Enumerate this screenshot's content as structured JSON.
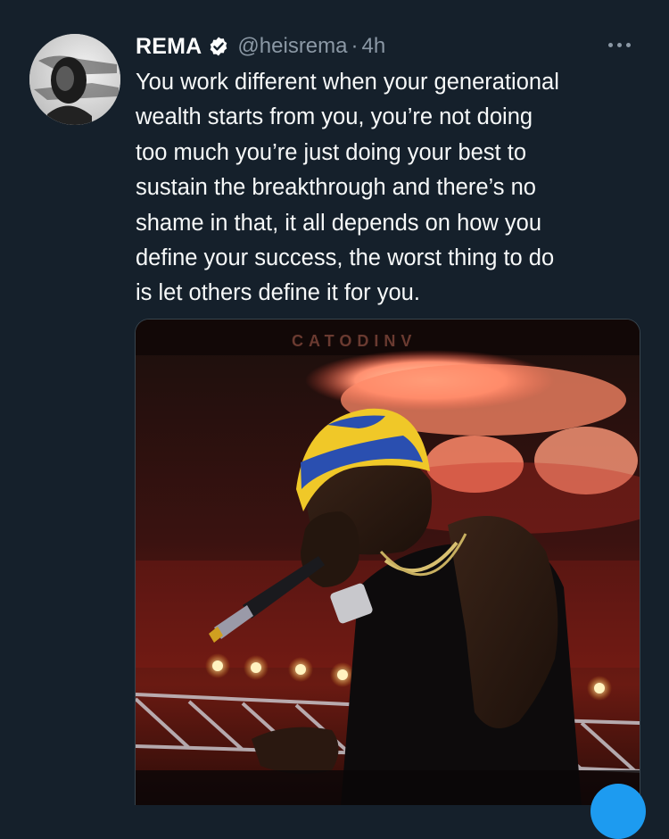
{
  "tweet": {
    "author": {
      "display_name": "REMA",
      "handle": "@heisrema",
      "verified": true,
      "avatar_icon": "profile-avatar"
    },
    "separator": "·",
    "time": "4h",
    "more_icon": "more-horizontal-icon",
    "text_lines": [
      "You work different when your generational",
      "wealth starts from you, you’re not doing",
      "too much you’re just doing your best to",
      "sustain the breakthrough and there’s no",
      "shame in that, it all depends on how you",
      "define your success, the worst thing to do",
      "is let others define it for you."
    ],
    "media": {
      "kind": "photo"
    }
  },
  "colors": {
    "background": "#15202b",
    "text": "#f7f9f9",
    "secondary": "#8b98a5",
    "accent": "#1d9bf0"
  }
}
